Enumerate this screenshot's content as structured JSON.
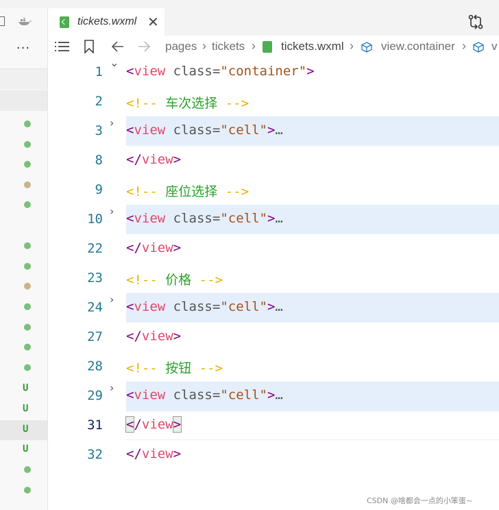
{
  "tab": {
    "filename": "tickets.wxml",
    "close": "✕"
  },
  "explorer": {
    "more": "···",
    "u_label": "U"
  },
  "breadcrumb": {
    "items": [
      "pages",
      "tickets",
      "tickets.wxml",
      "view.container",
      "v"
    ],
    "separator": "›"
  },
  "editor": {
    "lines": [
      {
        "num": "1",
        "open": "<",
        "name": "view",
        "attr": "class",
        "eq": "=",
        "val": "\"container\"",
        "close": ">"
      },
      {
        "num": "2",
        "cm_open": "<!--",
        "comment": "车次选择",
        "cm_close": "-->"
      },
      {
        "num": "3",
        "open": "<",
        "name": "view",
        "attr": "class",
        "eq": "=",
        "val": "\"cell\"",
        "close": ">",
        "ellipsis": "…"
      },
      {
        "num": "8",
        "open": "</",
        "name": "view",
        "close": ">"
      },
      {
        "num": "9",
        "cm_open": "<!--",
        "comment": "座位选择",
        "cm_close": "-->"
      },
      {
        "num": "10",
        "open": "<",
        "name": "view",
        "attr": "class",
        "eq": "=",
        "val": "\"cell\"",
        "close": ">",
        "ellipsis": "…"
      },
      {
        "num": "22",
        "open": "</",
        "name": "view",
        "close": ">"
      },
      {
        "num": "23",
        "cm_open": "<!--",
        "comment": "价格",
        "cm_close": "-->"
      },
      {
        "num": "24",
        "open": "<",
        "name": "view",
        "attr": "class",
        "eq": "=",
        "val": "\"cell\"",
        "close": ">",
        "ellipsis": "…"
      },
      {
        "num": "27",
        "open": "</",
        "name": "view",
        "close": ">"
      },
      {
        "num": "28",
        "cm_open": "<!--",
        "comment": "按钮",
        "cm_close": "-->"
      },
      {
        "num": "29",
        "open": "<",
        "name": "view",
        "attr": "class",
        "eq": "=",
        "val": "\"cell\"",
        "close": ">",
        "ellipsis": "…"
      },
      {
        "num": "31",
        "open": "<",
        "slash": "/",
        "name": "view",
        "close": ">"
      },
      {
        "num": "32",
        "open": "</",
        "name": "view",
        "close": ">"
      }
    ]
  },
  "colors": {
    "tag_bracket": "#800080",
    "tag_name": "#e0466a",
    "string": "#a4521a",
    "comment_marker": "#e8b100",
    "comment_text": "#2aa22a",
    "line_number": "#237893",
    "fold_highlight": "#e5effb"
  },
  "watermark": "CSDN @啥都会一点的小笨蛋~"
}
